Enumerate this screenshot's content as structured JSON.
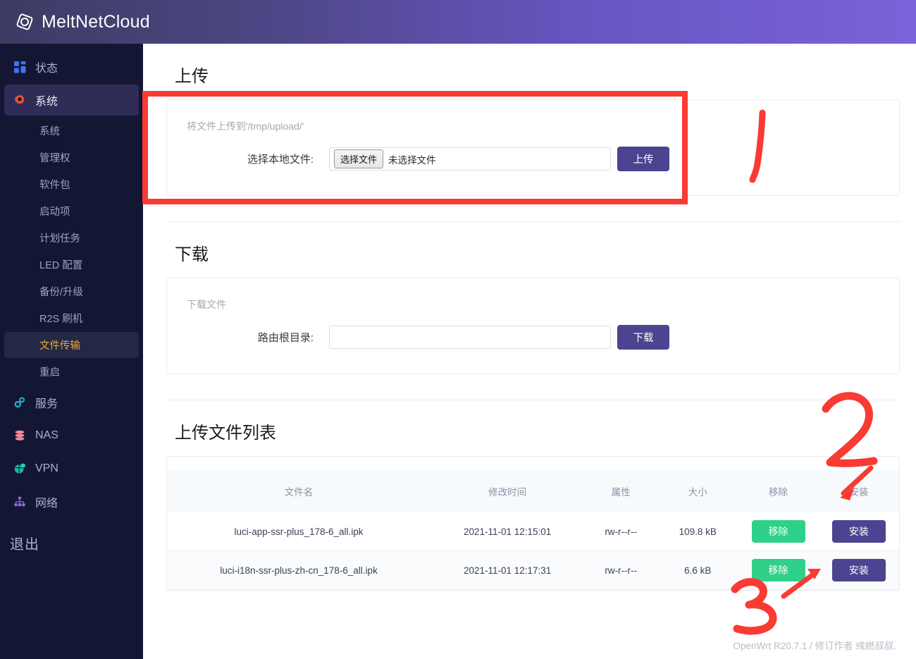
{
  "header": {
    "brand": "MeltNetCloud",
    "logo_icon": "atom-logo-icon"
  },
  "sidebar": {
    "items": [
      {
        "label": "状态",
        "icon": "grid-squares-icon",
        "type": "group",
        "active": false
      },
      {
        "label": "系统",
        "icon": "gear-icon",
        "type": "group",
        "active": true
      },
      {
        "label": "系统",
        "icon": "",
        "type": "sub",
        "selected": false
      },
      {
        "label": "管理权",
        "icon": "",
        "type": "sub",
        "selected": false
      },
      {
        "label": "软件包",
        "icon": "",
        "type": "sub",
        "selected": false
      },
      {
        "label": "启动项",
        "icon": "",
        "type": "sub",
        "selected": false
      },
      {
        "label": "计划任务",
        "icon": "",
        "type": "sub",
        "selected": false
      },
      {
        "label": "LED 配置",
        "icon": "",
        "type": "sub",
        "selected": false
      },
      {
        "label": "备份/升级",
        "icon": "",
        "type": "sub",
        "selected": false
      },
      {
        "label": "R2S 刷机",
        "icon": "",
        "type": "sub",
        "selected": false
      },
      {
        "label": "文件传输",
        "icon": "",
        "type": "sub",
        "selected": true
      },
      {
        "label": "重启",
        "icon": "",
        "type": "sub",
        "selected": false
      },
      {
        "label": "服务",
        "icon": "gears-icon",
        "type": "group",
        "active": false
      },
      {
        "label": "NAS",
        "icon": "database-icon",
        "type": "group",
        "active": false
      },
      {
        "label": "VPN",
        "icon": "globe-shield-icon",
        "type": "group",
        "active": false
      },
      {
        "label": "网络",
        "icon": "network-tree-icon",
        "type": "group",
        "active": false
      }
    ],
    "logout_label": "退出"
  },
  "upload": {
    "title": "上传",
    "hint": "将文件上传到'/tmp/upload/'",
    "field_label": "选择本地文件:",
    "choose_button": "选择文件",
    "no_file_text": "未选择文件",
    "submit_button": "上传"
  },
  "download": {
    "title": "下载",
    "hint": "下载文件",
    "field_label": "路由根目录:",
    "path_value": "",
    "path_placeholder": "",
    "submit_button": "下载"
  },
  "filelist": {
    "title": "上传文件列表",
    "columns": [
      "文件名",
      "修改时间",
      "属性",
      "大小",
      "移除",
      "安装"
    ],
    "rows": [
      {
        "name": "luci-app-ssr-plus_178-6_all.ipk",
        "mtime": "2021-11-01 12:15:01",
        "attr": "rw-r--r--",
        "size": "109.8 kB",
        "remove_label": "移除",
        "install_label": "安装"
      },
      {
        "name": "luci-i18n-ssr-plus-zh-cn_178-6_all.ipk",
        "mtime": "2021-11-01 12:17:31",
        "attr": "rw-r--r--",
        "size": "6.6 kB",
        "remove_label": "移除",
        "install_label": "安装"
      }
    ]
  },
  "footer": {
    "text": "OpenWrt R20.7.1 / 修订作者 彧繎叔叔."
  },
  "annotations": {
    "color": "#f93b33",
    "marks": [
      {
        "label": "1",
        "kind": "digit"
      },
      {
        "label": "2",
        "kind": "digit-with-arrow"
      },
      {
        "label": "3",
        "kind": "digit-with-arrow"
      }
    ],
    "highlight_box": "upload-panel-outline"
  },
  "colors": {
    "header_gradient_start": "#3d3b63",
    "header_gradient_end": "#7b62da",
    "sidebar_bg": "#141733",
    "sidebar_selected_text": "#f0a23c",
    "primary_button": "#4b4490",
    "remove_button": "#2fd08a",
    "annotation_red": "#f93b33"
  }
}
